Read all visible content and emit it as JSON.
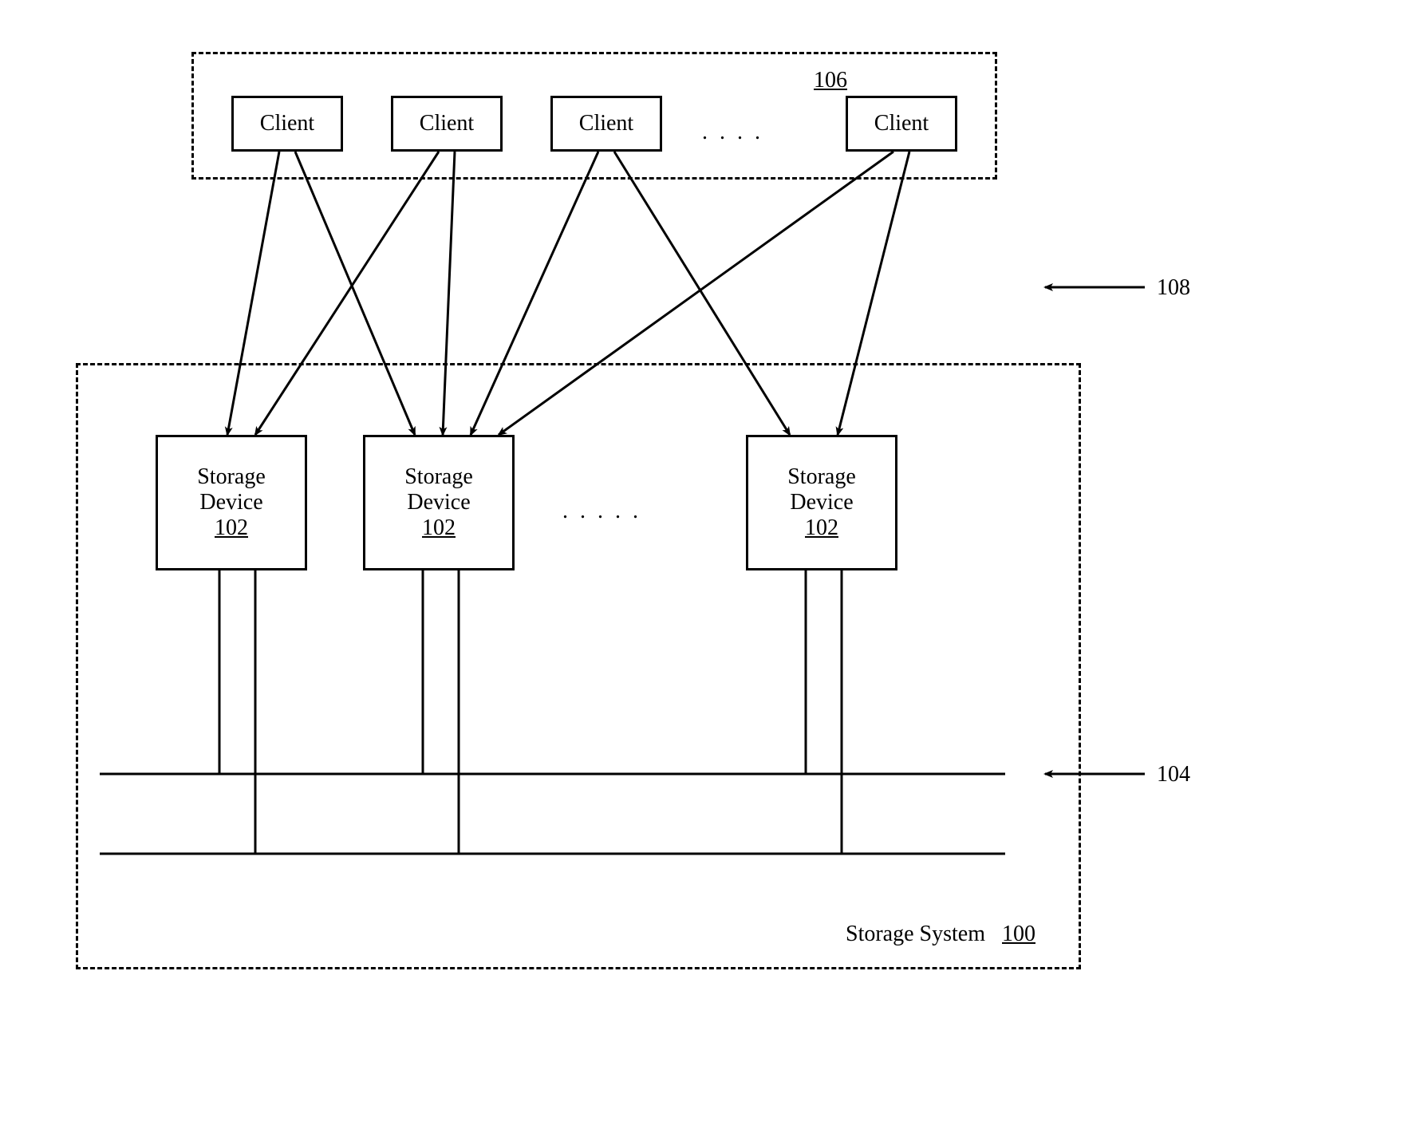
{
  "clients_group": {
    "ref_label": "106",
    "items": [
      {
        "label": "Client"
      },
      {
        "label": "Client"
      },
      {
        "label": "Client"
      },
      {
        "label": "Client"
      }
    ],
    "ellipsis": ".    .    .    ."
  },
  "network_ref": "108",
  "storage_system": {
    "title": "Storage System",
    "ref_label": "100",
    "devices": [
      {
        "line1": "Storage",
        "line2": "Device",
        "ref": "102"
      },
      {
        "line1": "Storage",
        "line2": "Device",
        "ref": "102"
      },
      {
        "line1": "Storage",
        "line2": "Device",
        "ref": "102"
      }
    ],
    "ellipsis": ".    .    .    .    ."
  },
  "bus_ref": "104"
}
